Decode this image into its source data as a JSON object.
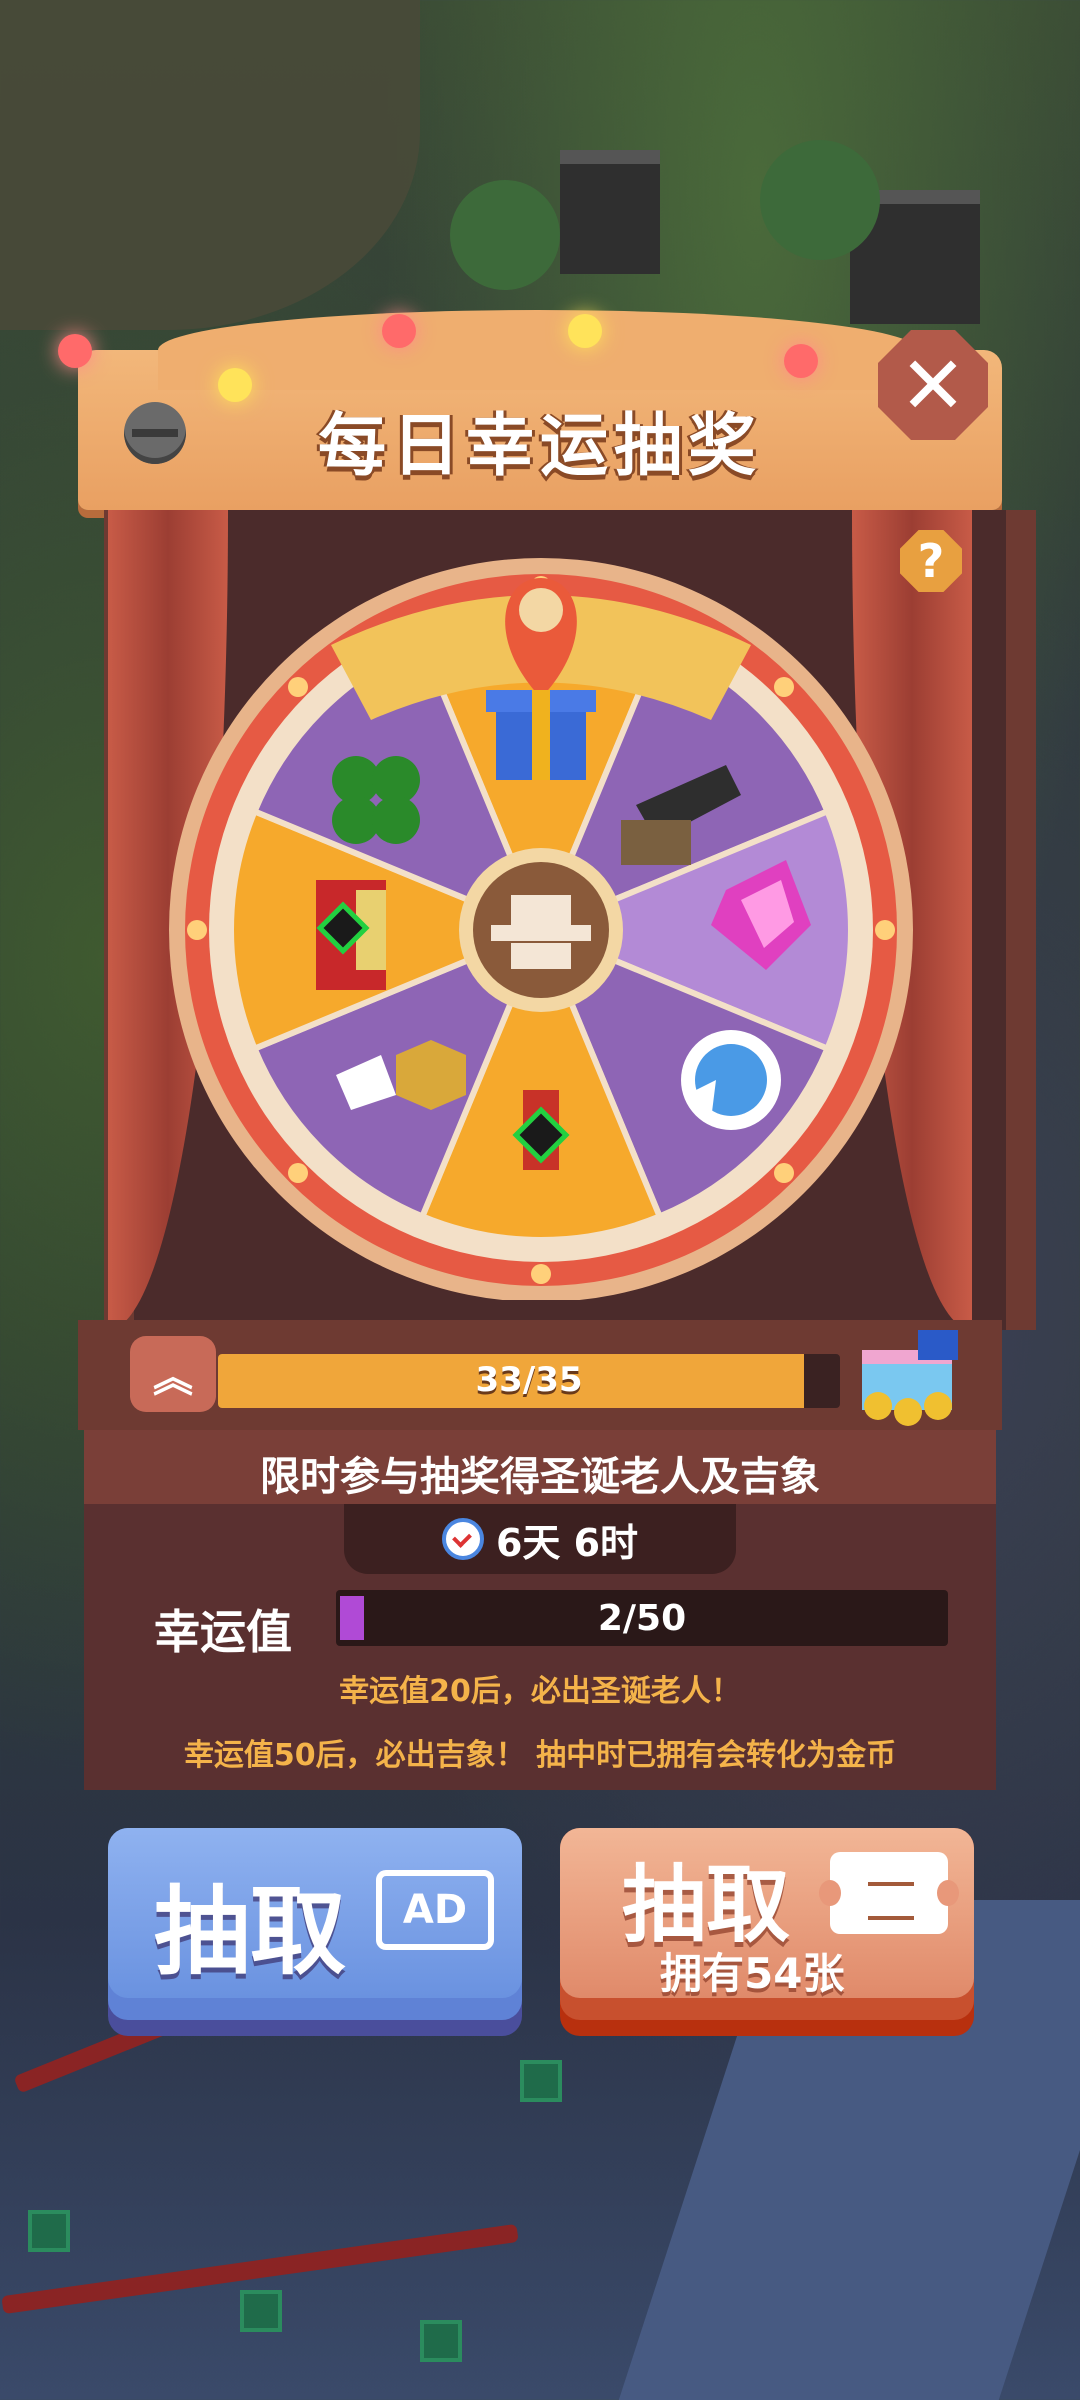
{
  "popup": {
    "title": "每日幸运抽奖",
    "close_icon": "close-icon",
    "help_label": "?"
  },
  "wheel": {
    "segments": [
      {
        "name": "gift-box",
        "color": "#f6a92c"
      },
      {
        "name": "cannon",
        "color": "#8e65b5"
      },
      {
        "name": "pink-heart-gem",
        "color": "#b38ad6"
      },
      {
        "name": "blue-arrow-coin",
        "color": "#8e65b5"
      },
      {
        "name": "santa-skin",
        "color": "#f6a92c"
      },
      {
        "name": "gold-coin",
        "color": "#8e65b5"
      },
      {
        "name": "jester-skin",
        "color": "#f6a92c"
      },
      {
        "name": "four-leaf-clover",
        "color": "#8e65b5"
      }
    ],
    "center_icon": "hat-icon"
  },
  "progress": {
    "text": "33/35",
    "value": 33,
    "max": 35
  },
  "event": {
    "title": "限时参与抽奖得圣诞老人及吉象",
    "timer": "6天 6时",
    "luck_label": "幸运值",
    "luck_text": "2/50",
    "luck_value": 2,
    "luck_max": 50,
    "note1": "幸运值20后，必出圣诞老人！",
    "note2": "幸运值50后，必出吉象！ 抽中时已拥有会转化为金币"
  },
  "buttons": {
    "ad_draw": "抽取",
    "ad_badge": "AD",
    "ticket_draw": "抽取",
    "ticket_count": "拥有54张"
  }
}
